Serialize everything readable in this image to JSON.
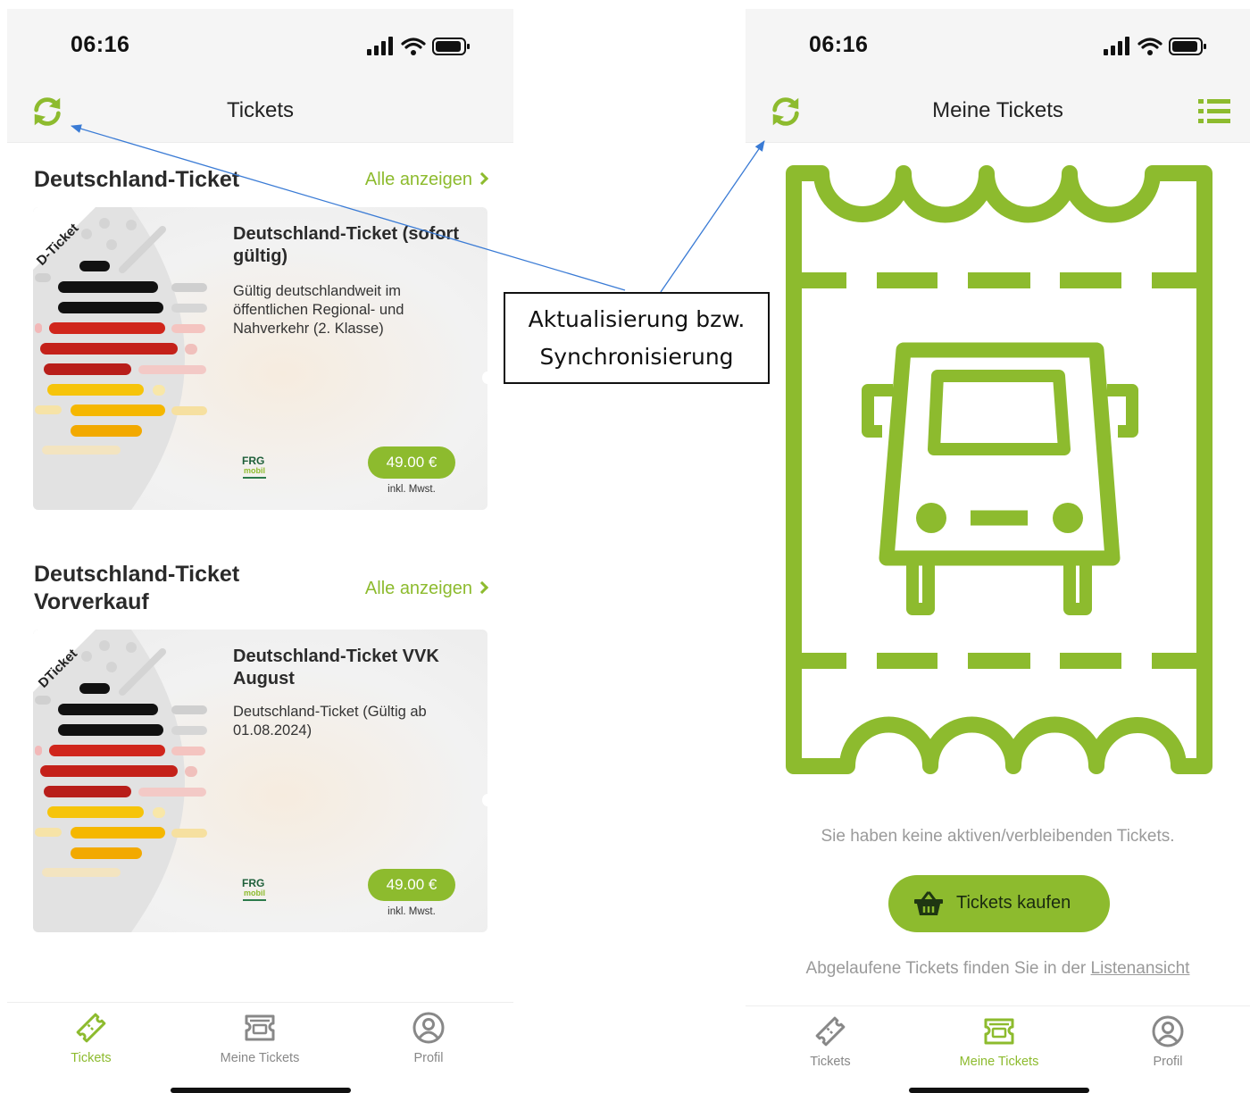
{
  "left_screen": {
    "status": {
      "time": "06:16"
    },
    "header": {
      "title": "Tickets"
    },
    "sections": [
      {
        "title": "Deutschland-Ticket",
        "see_all": "Alle anzeigen",
        "card": {
          "ribbon": "D-Ticket",
          "title": "Deutschland-Ticket (sofort gültig)",
          "description": "Gültig deutschlandweit im öffentlichen Regional- und Nahverkehr (2. Klasse)",
          "logo_text": "FRG",
          "logo_sub": "mobil",
          "price": "49.00 €",
          "price_note": "inkl. Mwst."
        }
      },
      {
        "title": "Deutschland-Ticket Vorverkauf",
        "see_all": "Alle anzeigen",
        "card": {
          "ribbon": "DTicket",
          "title": "Deutschland-Ticket VVK August",
          "description": "Deutschland-Ticket (Gültig ab 01.08.2024)",
          "logo_text": "FRG",
          "logo_sub": "mobil",
          "price": "49.00 €",
          "price_note": "inkl. Mwst."
        }
      }
    ],
    "tabs": [
      {
        "label": "Tickets",
        "icon": "ticket-icon",
        "active": true
      },
      {
        "label": "Meine Tickets",
        "icon": "my-tickets-icon",
        "active": false
      },
      {
        "label": "Profil",
        "icon": "profile-icon",
        "active": false
      }
    ]
  },
  "right_screen": {
    "status": {
      "time": "06:16"
    },
    "header": {
      "title": "Meine Tickets"
    },
    "empty_message": "Sie haben keine aktiven/verbleibenden Tickets.",
    "buy_button": "Tickets kaufen",
    "expired_prefix": "Abgelaufene Tickets finden Sie in der",
    "expired_link": "Listenansicht",
    "tabs": [
      {
        "label": "Tickets",
        "icon": "ticket-icon",
        "active": false
      },
      {
        "label": "Meine Tickets",
        "icon": "my-tickets-icon",
        "active": true
      },
      {
        "label": "Profil",
        "icon": "profile-icon",
        "active": false
      }
    ]
  },
  "annotation": {
    "line1": "Aktualisierung bzw.",
    "line2": "Synchronisierung"
  },
  "colors": {
    "accent": "#8dbb2e",
    "background": "#ffffff",
    "header_bg": "#f5f5f5",
    "text": "#2a2a2a",
    "muted": "#9a9a9a",
    "arrow": "#3a7bd5"
  }
}
